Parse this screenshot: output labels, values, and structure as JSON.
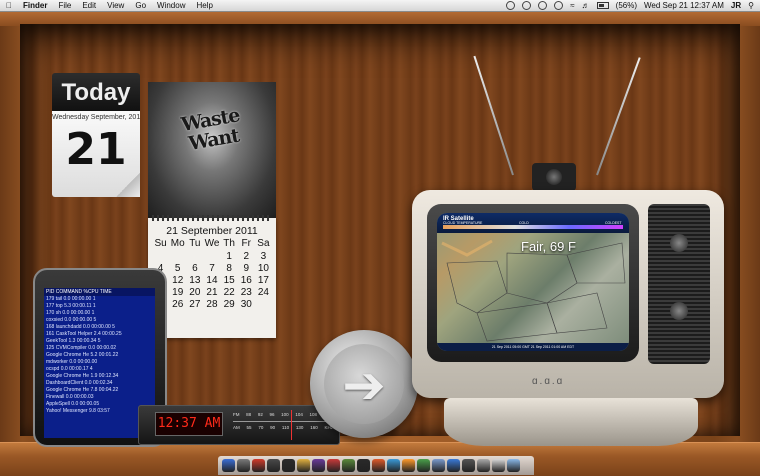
{
  "menubar": {
    "app": "Finder",
    "menus": [
      "File",
      "Edit",
      "View",
      "Go",
      "Window",
      "Help"
    ],
    "battery": "(56%)",
    "clock": "Wed Sep 21  12:37 AM",
    "user": "JR"
  },
  "today_widget": {
    "header": "Today",
    "date_line": "Wednesday September, 2011",
    "day": "21"
  },
  "wall_calendar": {
    "poster_text": "Waste Want",
    "title": "21 September 2011",
    "weekdays": [
      "Su",
      "Mo",
      "Tu",
      "We",
      "Th",
      "Fr",
      "Sa"
    ],
    "days": [
      "",
      "",
      "",
      "",
      "1",
      "2",
      "3",
      "4",
      "5",
      "6",
      "7",
      "8",
      "9",
      "10",
      "11",
      "12",
      "13",
      "14",
      "15",
      "16",
      "17",
      "18",
      "19",
      "20",
      "21",
      "22",
      "23",
      "24",
      "25",
      "26",
      "27",
      "28",
      "29",
      "30",
      ""
    ]
  },
  "activity_monitor": {
    "header": "PID COMMAND      %CPU TIME",
    "rows": [
      "179 tail          0.0 00:00.00 1",
      "177 top           5.3 00:00.11 1",
      "170 sh            0.0 00:00.00 1",
      "    coxsied       0.0 00:00.00 5",
      "168 launchdadd    0.0 00:00.00 5",
      "161 CaskTool Helper 2.4 00:00.25",
      "    GeekTool      1.3 00:00.34 5",
      "125 CVMCompiler   0.0 00:00.02",
      "    Google Chrome He 5.2 00:01.22",
      "    mdworker      0.0 00:00.00",
      "    ocspd         0.0 00:00.17 4",
      "    Google Chrome He 1.9 00:12.34",
      "    DashboardClient 0.0 00:02.34",
      "    Google Chrome He 7.8 00:04.22",
      "    Finewall      0.0 00:00.03",
      "    AppleSpell    0.0 00:00.05",
      "    Yahoo! Messenger 9.8 03:57"
    ]
  },
  "radio_clock": {
    "time": "12:37 AM",
    "fm_scale": [
      "FM",
      "88",
      "92",
      "96",
      "100",
      "104",
      "108",
      "MHz"
    ],
    "am_scale": [
      "AM",
      "55",
      "70",
      "90",
      "110",
      "130",
      "160",
      "KHz"
    ]
  },
  "tv": {
    "channel_title": "IR Satellite",
    "legend_left": "CLOUD TEMPERATURE",
    "legend_mid": "COLD",
    "legend_right": "COLDEST",
    "weather": "Fair, 69 F",
    "footer": "21 Sep 2011 05:00 GMT  21 Sep 2011 01:00 AM EDT",
    "brand": "ɑ.ɑ.ɑ"
  },
  "arrow_widget": {
    "glyph": "➔"
  },
  "dock_colors": [
    "#3a6fd8",
    "#7a7a7a",
    "#d23a2a",
    "#4a4a4a",
    "#2b2b2b",
    "#e0b040",
    "#6a3a9a",
    "#c83a3a",
    "#5a8a3a",
    "#2a2a2a",
    "#e05a2a",
    "#3a9ad8",
    "#ff9a2a",
    "#4aa04a",
    "#7a9acd",
    "#3a7ad8",
    "#555555",
    "#aaaaaa",
    "#d8d8d8",
    "#8ab8e8"
  ]
}
